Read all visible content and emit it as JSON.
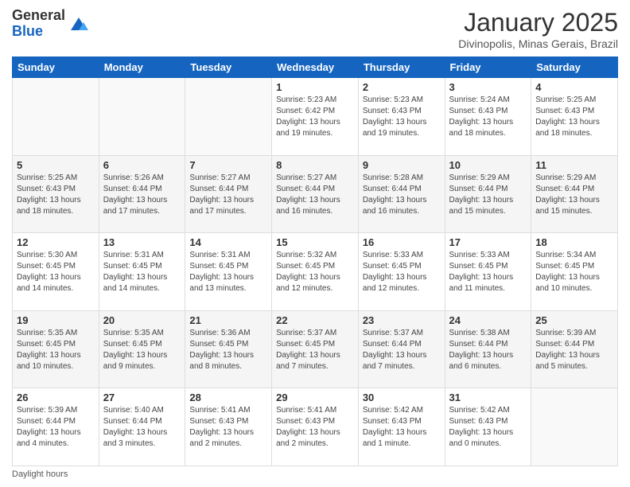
{
  "logo": {
    "general": "General",
    "blue": "Blue"
  },
  "header": {
    "month": "January 2025",
    "location": "Divinopolis, Minas Gerais, Brazil"
  },
  "weekdays": [
    "Sunday",
    "Monday",
    "Tuesday",
    "Wednesday",
    "Thursday",
    "Friday",
    "Saturday"
  ],
  "weeks": [
    [
      {
        "day": "",
        "info": ""
      },
      {
        "day": "",
        "info": ""
      },
      {
        "day": "",
        "info": ""
      },
      {
        "day": "1",
        "info": "Sunrise: 5:23 AM\nSunset: 6:42 PM\nDaylight: 13 hours\nand 19 minutes."
      },
      {
        "day": "2",
        "info": "Sunrise: 5:23 AM\nSunset: 6:43 PM\nDaylight: 13 hours\nand 19 minutes."
      },
      {
        "day": "3",
        "info": "Sunrise: 5:24 AM\nSunset: 6:43 PM\nDaylight: 13 hours\nand 18 minutes."
      },
      {
        "day": "4",
        "info": "Sunrise: 5:25 AM\nSunset: 6:43 PM\nDaylight: 13 hours\nand 18 minutes."
      }
    ],
    [
      {
        "day": "5",
        "info": "Sunrise: 5:25 AM\nSunset: 6:43 PM\nDaylight: 13 hours\nand 18 minutes."
      },
      {
        "day": "6",
        "info": "Sunrise: 5:26 AM\nSunset: 6:44 PM\nDaylight: 13 hours\nand 17 minutes."
      },
      {
        "day": "7",
        "info": "Sunrise: 5:27 AM\nSunset: 6:44 PM\nDaylight: 13 hours\nand 17 minutes."
      },
      {
        "day": "8",
        "info": "Sunrise: 5:27 AM\nSunset: 6:44 PM\nDaylight: 13 hours\nand 16 minutes."
      },
      {
        "day": "9",
        "info": "Sunrise: 5:28 AM\nSunset: 6:44 PM\nDaylight: 13 hours\nand 16 minutes."
      },
      {
        "day": "10",
        "info": "Sunrise: 5:29 AM\nSunset: 6:44 PM\nDaylight: 13 hours\nand 15 minutes."
      },
      {
        "day": "11",
        "info": "Sunrise: 5:29 AM\nSunset: 6:44 PM\nDaylight: 13 hours\nand 15 minutes."
      }
    ],
    [
      {
        "day": "12",
        "info": "Sunrise: 5:30 AM\nSunset: 6:45 PM\nDaylight: 13 hours\nand 14 minutes."
      },
      {
        "day": "13",
        "info": "Sunrise: 5:31 AM\nSunset: 6:45 PM\nDaylight: 13 hours\nand 14 minutes."
      },
      {
        "day": "14",
        "info": "Sunrise: 5:31 AM\nSunset: 6:45 PM\nDaylight: 13 hours\nand 13 minutes."
      },
      {
        "day": "15",
        "info": "Sunrise: 5:32 AM\nSunset: 6:45 PM\nDaylight: 13 hours\nand 12 minutes."
      },
      {
        "day": "16",
        "info": "Sunrise: 5:33 AM\nSunset: 6:45 PM\nDaylight: 13 hours\nand 12 minutes."
      },
      {
        "day": "17",
        "info": "Sunrise: 5:33 AM\nSunset: 6:45 PM\nDaylight: 13 hours\nand 11 minutes."
      },
      {
        "day": "18",
        "info": "Sunrise: 5:34 AM\nSunset: 6:45 PM\nDaylight: 13 hours\nand 10 minutes."
      }
    ],
    [
      {
        "day": "19",
        "info": "Sunrise: 5:35 AM\nSunset: 6:45 PM\nDaylight: 13 hours\nand 10 minutes."
      },
      {
        "day": "20",
        "info": "Sunrise: 5:35 AM\nSunset: 6:45 PM\nDaylight: 13 hours\nand 9 minutes."
      },
      {
        "day": "21",
        "info": "Sunrise: 5:36 AM\nSunset: 6:45 PM\nDaylight: 13 hours\nand 8 minutes."
      },
      {
        "day": "22",
        "info": "Sunrise: 5:37 AM\nSunset: 6:45 PM\nDaylight: 13 hours\nand 7 minutes."
      },
      {
        "day": "23",
        "info": "Sunrise: 5:37 AM\nSunset: 6:44 PM\nDaylight: 13 hours\nand 7 minutes."
      },
      {
        "day": "24",
        "info": "Sunrise: 5:38 AM\nSunset: 6:44 PM\nDaylight: 13 hours\nand 6 minutes."
      },
      {
        "day": "25",
        "info": "Sunrise: 5:39 AM\nSunset: 6:44 PM\nDaylight: 13 hours\nand 5 minutes."
      }
    ],
    [
      {
        "day": "26",
        "info": "Sunrise: 5:39 AM\nSunset: 6:44 PM\nDaylight: 13 hours\nand 4 minutes."
      },
      {
        "day": "27",
        "info": "Sunrise: 5:40 AM\nSunset: 6:44 PM\nDaylight: 13 hours\nand 3 minutes."
      },
      {
        "day": "28",
        "info": "Sunrise: 5:41 AM\nSunset: 6:43 PM\nDaylight: 13 hours\nand 2 minutes."
      },
      {
        "day": "29",
        "info": "Sunrise: 5:41 AM\nSunset: 6:43 PM\nDaylight: 13 hours\nand 2 minutes."
      },
      {
        "day": "30",
        "info": "Sunrise: 5:42 AM\nSunset: 6:43 PM\nDaylight: 13 hours\nand 1 minute."
      },
      {
        "day": "31",
        "info": "Sunrise: 5:42 AM\nSunset: 6:43 PM\nDaylight: 13 hours\nand 0 minutes."
      },
      {
        "day": "",
        "info": ""
      }
    ]
  ],
  "footer": {
    "daylight_label": "Daylight hours"
  }
}
